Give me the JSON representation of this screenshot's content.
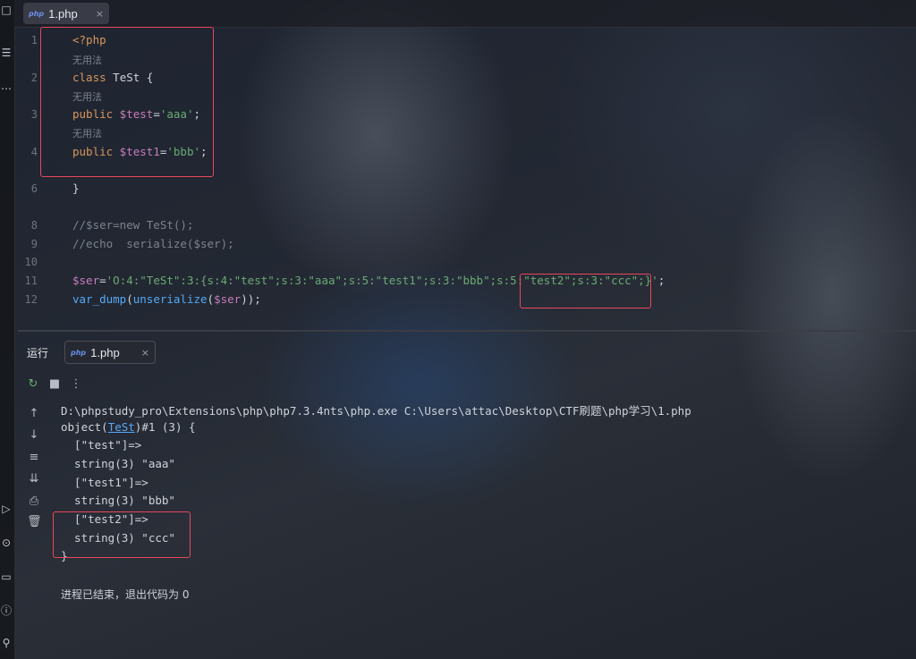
{
  "tab": {
    "icon": "php",
    "label": "1.php",
    "close": "×"
  },
  "editor": {
    "line_numbers": [
      "1",
      "2",
      "3",
      "4",
      "6",
      "8",
      "9",
      "10",
      "11",
      "12"
    ],
    "hint_label": "无用法",
    "lines": {
      "l1": "<?php",
      "l2_kw": "class",
      "l2_rest": " TeSt {",
      "l3_kw": "public",
      "l3_var": " $test",
      "l3_eq": "=",
      "l3_str": "'aaa'",
      "l3_end": ";",
      "l4_kw": "public",
      "l4_var": " $test1",
      "l4_eq": "=",
      "l4_str": "'bbb'",
      "l4_end": ";",
      "l6": "}",
      "l8": "//$ser=new TeSt();",
      "l9": "//echo  serialize($ser);",
      "l11_var": "$ser",
      "l11_eq": "=",
      "l11_str": "'O:4:\"TeSt\":3:{s:4:\"test\";s:3:\"aaa\";s:5:\"test1\";s:3:\"bbb\";s:5:\"test2\";s:3:\"ccc\";}'",
      "l11_end": ";",
      "l12_fn1": "var_dump",
      "l12_p1": "(",
      "l12_fn2": "unserialize",
      "l12_p2": "(",
      "l12_var": "$ser",
      "l12_end": "));"
    }
  },
  "run_panel": {
    "title": "运行",
    "tab_label": "1.php",
    "tab_close": "×",
    "output": {
      "cmd": "D:\\phpstudy_pro\\Extensions\\php\\php7.3.4nts\\php.exe C:\\Users\\attac\\Desktop\\CTF刷题\\php学习\\1.php",
      "obj_pre": "object(",
      "obj_class": "TeSt",
      "obj_post": ")#1 (3) {",
      "o1": "  [\"test\"]=>",
      "o2": "  string(3) \"aaa\"",
      "o3": "  [\"test1\"]=>",
      "o4": "  string(3) \"bbb\"",
      "o5": "  [\"test2\"]=>",
      "o6": "  string(3) \"ccc\"",
      "o7": "}",
      "exit": "进程已结束，退出代码为 0"
    }
  },
  "colors": {
    "highlight_box": "#e8475b",
    "keyword": "#d7955b",
    "string": "#6aab73",
    "variable": "#c77dbb",
    "function": "#56a8f5"
  }
}
